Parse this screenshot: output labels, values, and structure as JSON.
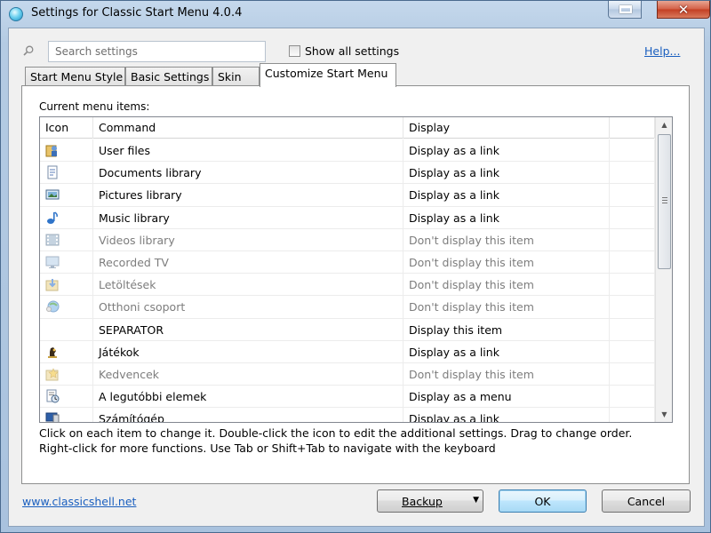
{
  "window": {
    "title": "Settings for Classic Start Menu 4.0.4"
  },
  "search": {
    "placeholder": "Search settings",
    "value": ""
  },
  "show_all": {
    "label": "Show all settings",
    "checked": false
  },
  "help_link": "Help...",
  "tabs": [
    {
      "label": "Start Menu Style",
      "active": false
    },
    {
      "label": "Basic Settings",
      "active": false
    },
    {
      "label": "Skin",
      "active": false
    },
    {
      "label": "Customize Start Menu",
      "active": true
    }
  ],
  "panel": {
    "current_label": "Current menu items:",
    "columns": {
      "icon": "Icon",
      "command": "Command",
      "display": "Display"
    },
    "rows": [
      {
        "icon": "user-files-icon",
        "command": "User files",
        "display": "Display as a link",
        "dim": false
      },
      {
        "icon": "documents-icon",
        "command": "Documents library",
        "display": "Display as a link",
        "dim": false
      },
      {
        "icon": "pictures-icon",
        "command": "Pictures library",
        "display": "Display as a link",
        "dim": false
      },
      {
        "icon": "music-icon",
        "command": "Music library",
        "display": "Display as a link",
        "dim": false
      },
      {
        "icon": "videos-icon",
        "command": "Videos library",
        "display": "Don't display this item",
        "dim": true
      },
      {
        "icon": "recorded-tv-icon",
        "command": "Recorded TV",
        "display": "Don't display this item",
        "dim": true
      },
      {
        "icon": "downloads-icon",
        "command": "Letöltések",
        "display": "Don't display this item",
        "dim": true
      },
      {
        "icon": "homegroup-icon",
        "command": "Otthoni csoport",
        "display": "Don't display this item",
        "dim": true
      },
      {
        "icon": "",
        "command": "SEPARATOR",
        "display": "Display this item",
        "dim": false
      },
      {
        "icon": "games-icon",
        "command": "Játékok",
        "display": "Display as a link",
        "dim": false
      },
      {
        "icon": "favorites-icon",
        "command": "Kedvencek",
        "display": "Don't display this item",
        "dim": true
      },
      {
        "icon": "recent-items-icon",
        "command": "A legutóbbi elemek",
        "display": "Display as a menu",
        "dim": false
      },
      {
        "icon": "computer-icon",
        "command": "Számítógép",
        "display": "Display as a link",
        "dim": false
      }
    ],
    "hint_line1": "Click on each item to change it. Double-click the icon to edit the additional settings. Drag to change order.",
    "hint_line2": "Right-click for more functions. Use Tab or Shift+Tab to navigate with the keyboard"
  },
  "footer": {
    "site_link": "www.classicshell.net",
    "backup_label": "Backup",
    "ok_label": "OK",
    "cancel_label": "Cancel"
  },
  "colors": {
    "link": "#1a5fbf",
    "dim_text": "#7d7d7d",
    "ok_border": "#3c7fb1"
  }
}
